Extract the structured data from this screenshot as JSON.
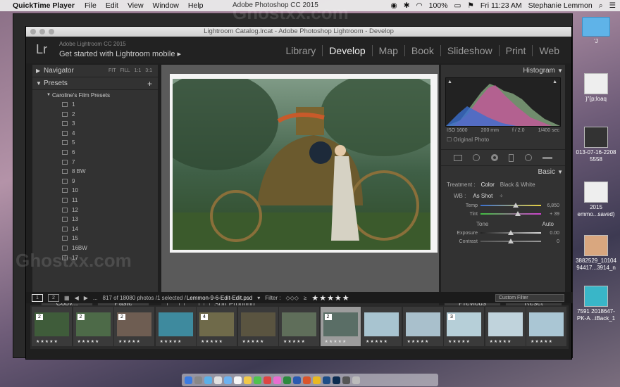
{
  "menubar": {
    "app_name": "QuickTime Player",
    "menus": [
      "File",
      "Edit",
      "View",
      "Window",
      "Help"
    ],
    "center_title": "Adobe Photoshop CC 2015",
    "battery": "100%",
    "clock": "Fri 11:23 AM",
    "user": "Stephanie Lemmon"
  },
  "window": {
    "title": "Lightroom Catalog.lrcat - Adobe Photoshop Lightroom - Develop"
  },
  "topbar": {
    "logo": "Lr",
    "version": "Adobe Lightroom CC 2015",
    "mobile": "Get started with Lightroom mobile",
    "modules": [
      "Library",
      "Develop",
      "Map",
      "Book",
      "Slideshow",
      "Print",
      "Web"
    ],
    "active_module": "Develop"
  },
  "left_panel": {
    "navigator": "Navigator",
    "nav_options": [
      "FIT",
      "FILL",
      "1:1",
      "3:1"
    ],
    "presets": "Presets",
    "preset_group": "Caroline's Film Presets",
    "preset_items": [
      "1",
      "2",
      "3",
      "4",
      "5",
      "6",
      "7",
      "8 BW",
      "9",
      "10",
      "11",
      "12",
      "13",
      "14",
      "15",
      "16BW",
      "17"
    ],
    "copy_button": "Copy...",
    "paste_button": "Paste"
  },
  "toolbar": {
    "soft_proofing": "Soft Proofing"
  },
  "right_panel": {
    "histogram": "Histogram",
    "iso": "ISO 1600",
    "focal": "200 mm",
    "aperture": "f / 2.0",
    "shutter": "1/400 sec",
    "original_photo": "Original Photo",
    "basic": "Basic",
    "treatment_label": "Treatment :",
    "treatment_color": "Color",
    "treatment_bw": "Black & White",
    "wb_label": "WB :",
    "wb_value": "As Shot",
    "temp_label": "Temp",
    "temp_value": "6,850",
    "tint_label": "Tint",
    "tint_value": "+ 39",
    "tone_label": "Tone",
    "tone_auto": "Auto",
    "exposure_label": "Exposure",
    "exposure_value": "0.00",
    "contrast_label": "Contrast",
    "contrast_value": "0",
    "previous_button": "Previous",
    "reset_button": "Reset"
  },
  "film_bar": {
    "page1": "1",
    "page2": "2",
    "dots": "...",
    "count": "817 of 18080 photos /1 selected /",
    "filename": "Lemmon-9-6-Edit-Edit.psd",
    "filter_label": "Filter :",
    "stars": "★★★★★",
    "custom_filter": "Custom Filter"
  },
  "filmstrip": {
    "badges": [
      "2",
      "2",
      "2",
      "",
      "4",
      "",
      "",
      "2",
      "",
      "",
      "3",
      "",
      ""
    ],
    "rating": "★★★★★"
  },
  "desktop": {
    "labels": [
      "'J",
      "}\"{p;loaq",
      "013-07-16-2208 5558",
      "2015 emmo...saved)",
      "3882529_10104 94417...3914_n",
      "7591 2018647- PK-A...tBack_1"
    ]
  },
  "watermark": "Ghostxx.com"
}
